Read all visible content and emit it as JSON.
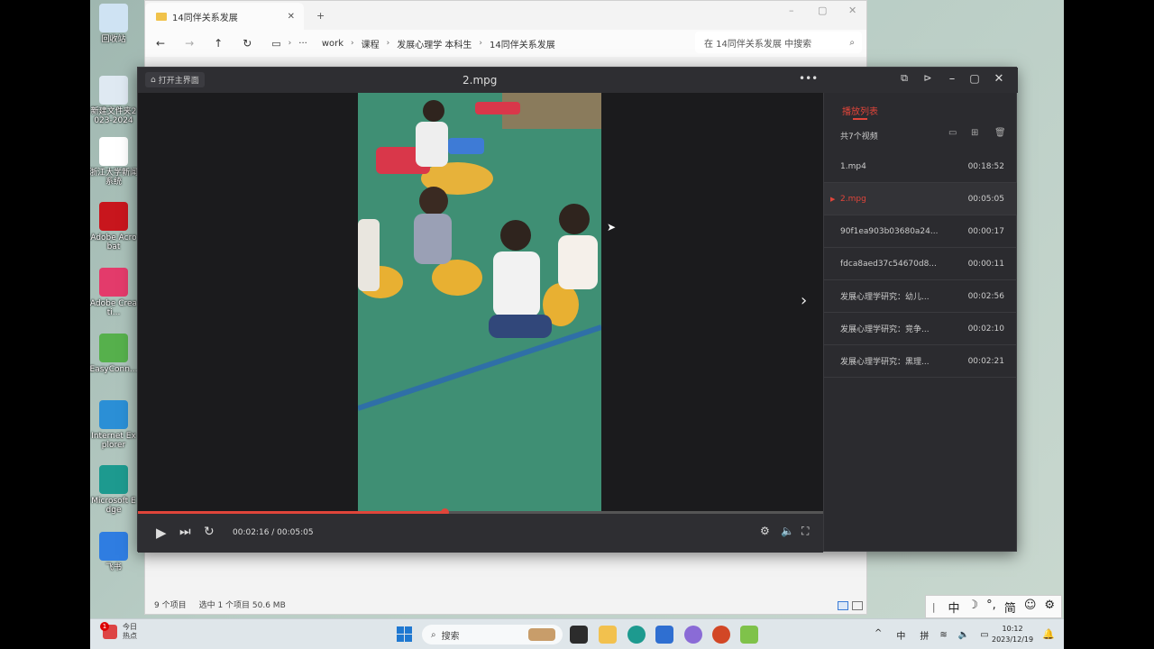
{
  "desktop": {
    "icons": [
      {
        "label": "回收站",
        "icon": "recycle-bin-icon",
        "color": "#cfe3f3"
      },
      {
        "label": "新建文件夹2023-2024",
        "icon": "folder-image-icon",
        "color": "#dfe9f2"
      },
      {
        "label": "浙江大学新闻系统",
        "icon": "pdf-icon",
        "color": "#ffffff"
      },
      {
        "label": "Adobe Acrobat",
        "icon": "acrobat-icon",
        "color": "#c8161d"
      },
      {
        "label": "Adobe Creati...",
        "icon": "creative-cloud-icon",
        "color": "#e33b6b"
      },
      {
        "label": "EasyConn...",
        "icon": "easyconnect-icon",
        "color": "#56b04c"
      },
      {
        "label": "Internet Explorer",
        "icon": "ie-icon",
        "color": "#2b8fd6"
      },
      {
        "label": "Microsoft Edge",
        "icon": "edge-icon",
        "color": "#1d9a8f"
      },
      {
        "label": "飞书",
        "icon": "feishu-icon",
        "color": "#2f7de1"
      }
    ]
  },
  "explorer": {
    "tab_title": "14同伴关系发展",
    "new_tab": "+",
    "close_tab": "✕",
    "breadcrumbs": [
      "work",
      "课程",
      "发展心理学 本科生",
      "14同伴关系发展"
    ],
    "more": "···",
    "search_placeholder": "在 14同伴关系发展 中搜索",
    "status": {
      "items": "9 个项目",
      "selected": "选中 1 个项目  50.6 MB"
    }
  },
  "player": {
    "home_label": "打开主界面",
    "title": "2.mpg",
    "time": "00:02:16 / 00:05:05",
    "progress": 0.447,
    "playlist": {
      "tab": "播放列表",
      "count": "共7个视频",
      "items": [
        {
          "name": "1.mp4",
          "duration": "00:18:52",
          "active": false
        },
        {
          "name": "2.mpg",
          "duration": "00:05:05",
          "active": true
        },
        {
          "name": "90f1ea903b03680a24...",
          "duration": "00:00:17",
          "active": false
        },
        {
          "name": "fdca8aed37c54670d8...",
          "duration": "00:00:11",
          "active": false
        },
        {
          "name": "发展心理学研究：幼儿...",
          "duration": "00:02:56",
          "active": false
        },
        {
          "name": "发展心理学研究：竞争...",
          "duration": "00:02:10",
          "active": false
        },
        {
          "name": "发展心理学研究：黑理...",
          "duration": "00:02:21",
          "active": false
        }
      ]
    }
  },
  "ime": {
    "items": [
      "中",
      "☽",
      "°,",
      "简",
      "☺",
      "⚙"
    ]
  },
  "taskbar": {
    "weather_title": "今日",
    "weather_sub": "热点",
    "badge": "1",
    "search": "搜索",
    "tray": [
      "^",
      "中",
      "拼"
    ],
    "time": "10:12",
    "date": "2023/12/19"
  },
  "colors": {
    "accent": "#e0453a",
    "player_bg": "#2a2a2e"
  }
}
